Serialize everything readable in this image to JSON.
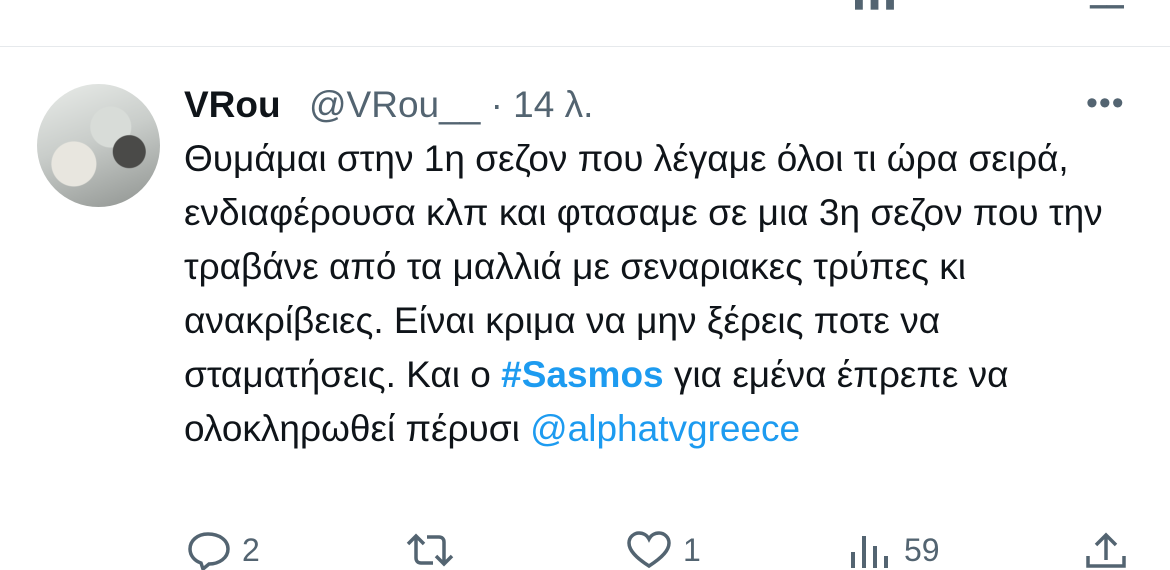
{
  "tweet": {
    "display_name": "VRou",
    "handle": "@VRou__",
    "separator": "·",
    "time": "14 λ.",
    "more": "•••",
    "body_segments": {
      "p1": "Θυμάμαι στην 1η σεζον που λέγαμε όλοι τι ώρα σειρά, ενδιαφέρουσα κλπ και φτασαμε σε μια 3η σεζον που την τραβάνε από τα μαλλιά με σεναριακες τρύπες κι ανακρίβειες. Είναι κριμα να μην ξέρεις ποτε να σταματήσεις. Και ο",
      "hashtag": "#Sasmos",
      "p2": "για εμένα έπρεπε να ολοκληρωθεί πέρυσι",
      "mention": "@alphatvgreece"
    },
    "actions": {
      "reply_count": "2",
      "retweet_count": "",
      "like_count": "1",
      "views_count": "59"
    }
  },
  "colors": {
    "accent": "#1d9bf0",
    "muted": "#536471",
    "text": "#0f1419"
  },
  "icons": {
    "reply": "comment-icon",
    "retweet": "retweet-icon",
    "like": "heart-icon",
    "views": "bar-chart-icon",
    "share": "share-icon"
  }
}
